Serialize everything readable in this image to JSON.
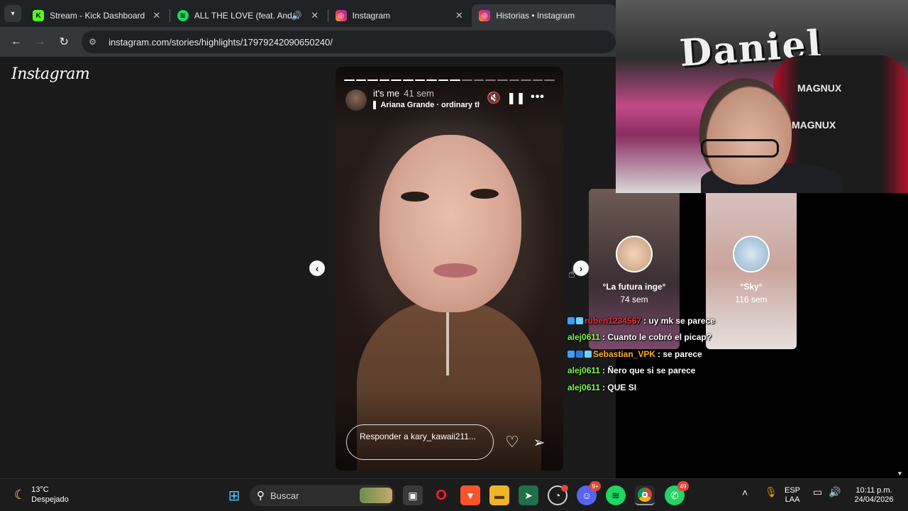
{
  "browser": {
    "tabs": [
      {
        "title": "Stream - Kick Dashboard",
        "icon": "kick-icon",
        "color": "#53fc18",
        "glyph": "K"
      },
      {
        "title": "ALL THE LOVE (feat. Andre",
        "icon": "spotify-icon",
        "color": "#1ed760",
        "glyph": "♫",
        "audio": "🔊"
      },
      {
        "title": "Instagram",
        "icon": "instagram-icon",
        "color": "#e1306c",
        "glyph": "◎"
      },
      {
        "title": "Historias • Instagram",
        "icon": "instagram-icon",
        "color": "#e1306c",
        "glyph": "◎"
      }
    ],
    "close_glyph": "✕",
    "url": "instagram.com/stories/highlights/17979242090650240/"
  },
  "instagram": {
    "logo": "Instagram",
    "story": {
      "user": "it's me",
      "time": "41 sem",
      "music": "Ariana Grande · ordinary th",
      "reply_placeholder": "Responder a kary_kawaii211...",
      "segments_total": 18,
      "segments_done": 10
    },
    "previews": [
      {
        "name": "°La futura inge°",
        "time": "74 sem"
      },
      {
        "name": "°Sky°",
        "time": "116 sem"
      }
    ]
  },
  "webcam": {
    "wall_text": "Daniel",
    "chair_brand": "MAGNUX"
  },
  "chat": [
    {
      "user": "ruben1234567",
      "color": "#e0303a",
      "message": ": uy mk se parece",
      "badges": [
        "#3aa0ff",
        "#6bd0ff"
      ]
    },
    {
      "user": "alej0611",
      "color": "#7cfc4a",
      "message": ": Cuanto le cobró el picap?",
      "badges": []
    },
    {
      "user": "Sebastian_VPK",
      "color": "#ffb020",
      "message": ": se parece",
      "badges": [
        "#3aa0ff",
        "#2f7bd8",
        "#6bd0ff"
      ]
    },
    {
      "user": "alej0611",
      "color": "#7cfc4a",
      "message": ": Ñero que si se parece",
      "badges": []
    },
    {
      "user": "alej0611",
      "color": "#7cfc4a",
      "message": ": QUE SI",
      "badges": []
    }
  ],
  "taskbar": {
    "weather_temp": "13°C",
    "weather_desc": "Despejado",
    "search_placeholder": "Buscar",
    "discord_badge": "9+",
    "whatsapp_badge": "49",
    "lang": "ESP",
    "layout": "LAA",
    "time": "10:11 p.m.",
    "date": "24/04/2026"
  }
}
